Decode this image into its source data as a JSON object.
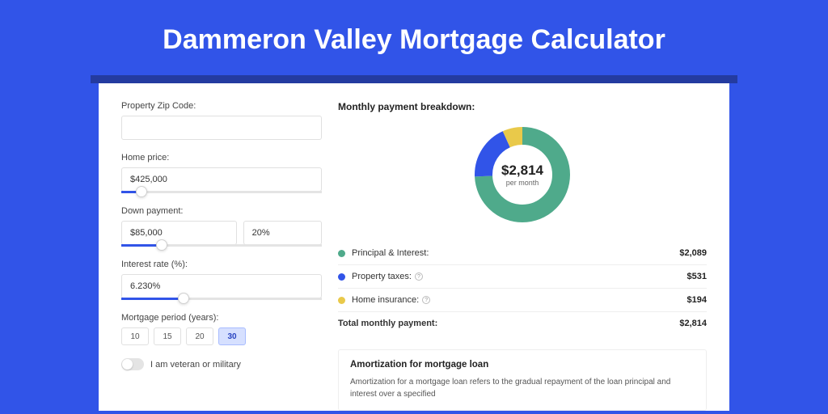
{
  "title": "Dammeron Valley Mortgage Calculator",
  "form": {
    "zip_label": "Property Zip Code:",
    "zip_value": "",
    "home_price_label": "Home price:",
    "home_price_value": "$425,000",
    "down_payment_label": "Down payment:",
    "down_payment_value": "$85,000",
    "down_payment_pct": "20%",
    "interest_label": "Interest rate (%):",
    "interest_value": "6.230%",
    "period_label": "Mortgage period (years):",
    "period_options": [
      "10",
      "15",
      "20",
      "30"
    ],
    "period_selected": "30",
    "veteran_label": "I am veteran or military"
  },
  "breakdown": {
    "heading": "Monthly payment breakdown:",
    "total_amount": "$2,814",
    "total_unit": "per month",
    "rows": [
      {
        "label": "Principal & Interest:",
        "value": "$2,089",
        "color": "#4faa8b"
      },
      {
        "label": "Property taxes:",
        "value": "$531",
        "color": "#3154e8",
        "info": true
      },
      {
        "label": "Home insurance:",
        "value": "$194",
        "color": "#e9c94a",
        "info": true
      }
    ],
    "total_row": {
      "label": "Total monthly payment:",
      "value": "$2,814"
    }
  },
  "amortization": {
    "title": "Amortization for mortgage loan",
    "text": "Amortization for a mortgage loan refers to the gradual repayment of the loan principal and interest over a specified"
  },
  "chart_data": {
    "type": "pie",
    "title": "Monthly payment breakdown",
    "series": [
      {
        "name": "Principal & Interest",
        "value": 2089,
        "color": "#4faa8b"
      },
      {
        "name": "Property taxes",
        "value": 531,
        "color": "#3154e8"
      },
      {
        "name": "Home insurance",
        "value": 194,
        "color": "#e9c94a"
      }
    ],
    "total": 2814,
    "unit": "per month"
  }
}
